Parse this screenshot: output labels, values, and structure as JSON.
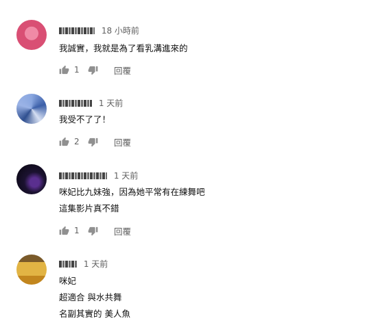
{
  "comments": [
    {
      "time": "18 小時前",
      "lines": [
        "我誠實，我就是為了看乳溝進來的"
      ],
      "likes": "1",
      "reply": "回覆",
      "avatar_color": "#d94f74"
    },
    {
      "time": "1 天前",
      "lines": [
        "我受不了了！"
      ],
      "likes": "2",
      "reply": "回覆",
      "avatar_color": "#4a6fb5"
    },
    {
      "time": "1 天前",
      "lines": [
        "咪妃比九妹強，因為她平常有在練舞吧",
        "這集影片真不錯"
      ],
      "likes": "1",
      "reply": "回覆",
      "avatar_color": "#1b1230"
    },
    {
      "time": "1 天前",
      "lines": [
        "咪妃",
        "超適合 與水共舞",
        "名副其實的 美人魚"
      ],
      "avatar_color": "#d4a02a"
    }
  ]
}
